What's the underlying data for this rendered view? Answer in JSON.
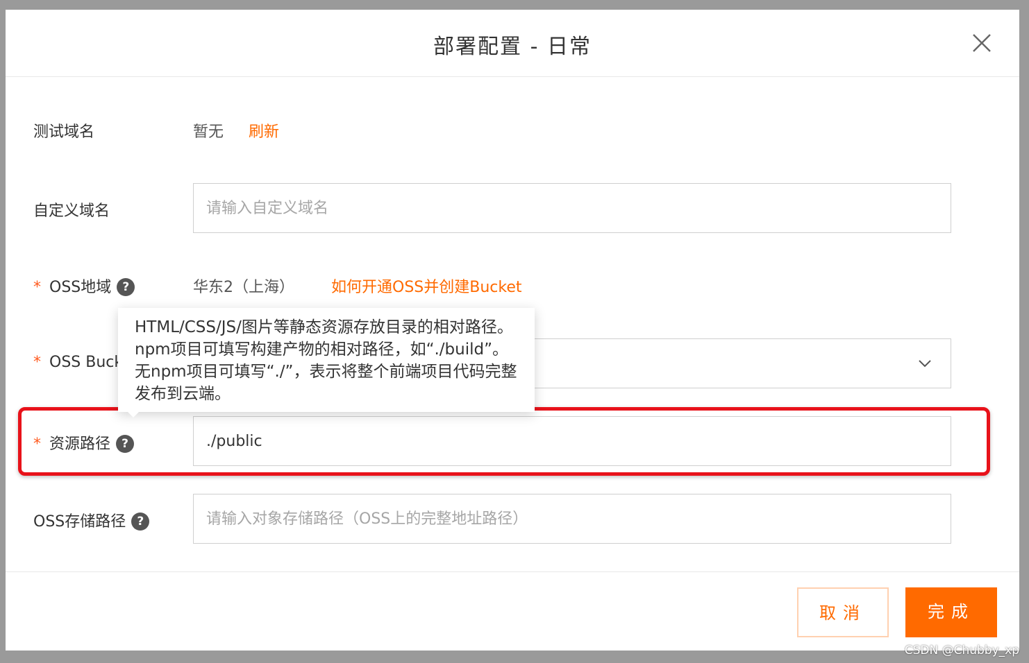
{
  "dialog": {
    "title": "部署配置 - 日常",
    "close_icon": "close-icon"
  },
  "test_domain": {
    "label": "测试域名",
    "value": "暂无",
    "refresh": "刷新"
  },
  "custom_domain": {
    "label": "自定义域名",
    "placeholder": "请输入自定义域名",
    "value": ""
  },
  "oss_region": {
    "required": "*",
    "label": "OSS地域",
    "help": "?",
    "value": "华东2（上海）",
    "link": "如何开通OSS并创建Bucket"
  },
  "oss_bucket": {
    "required": "*",
    "label": "OSS Bucket",
    "value": "",
    "dropdown_icon": "chevron-down-icon"
  },
  "resource_path": {
    "required": "*",
    "label": "资源路径",
    "help": "?",
    "value": "./public"
  },
  "oss_storage_path": {
    "label": "OSS存储路径",
    "help": "?",
    "placeholder": "请输入对象存储路径（OSS上的完整地址路径）",
    "value": ""
  },
  "tooltip": {
    "text": "HTML/CSS/JS/图片等静态资源存放目录的相对路径。npm项目可填写构建产物的相对路径，如“./build”。无npm项目可填写“./”，表示将整个前端项目代码完整发布到云端。"
  },
  "footer": {
    "cancel": "取消",
    "ok": "完成"
  },
  "watermark": "CSDN @Chubby_xp",
  "colors": {
    "accent": "#ff6a00",
    "highlight": "#e8121a",
    "required": "#ff5a1f"
  }
}
